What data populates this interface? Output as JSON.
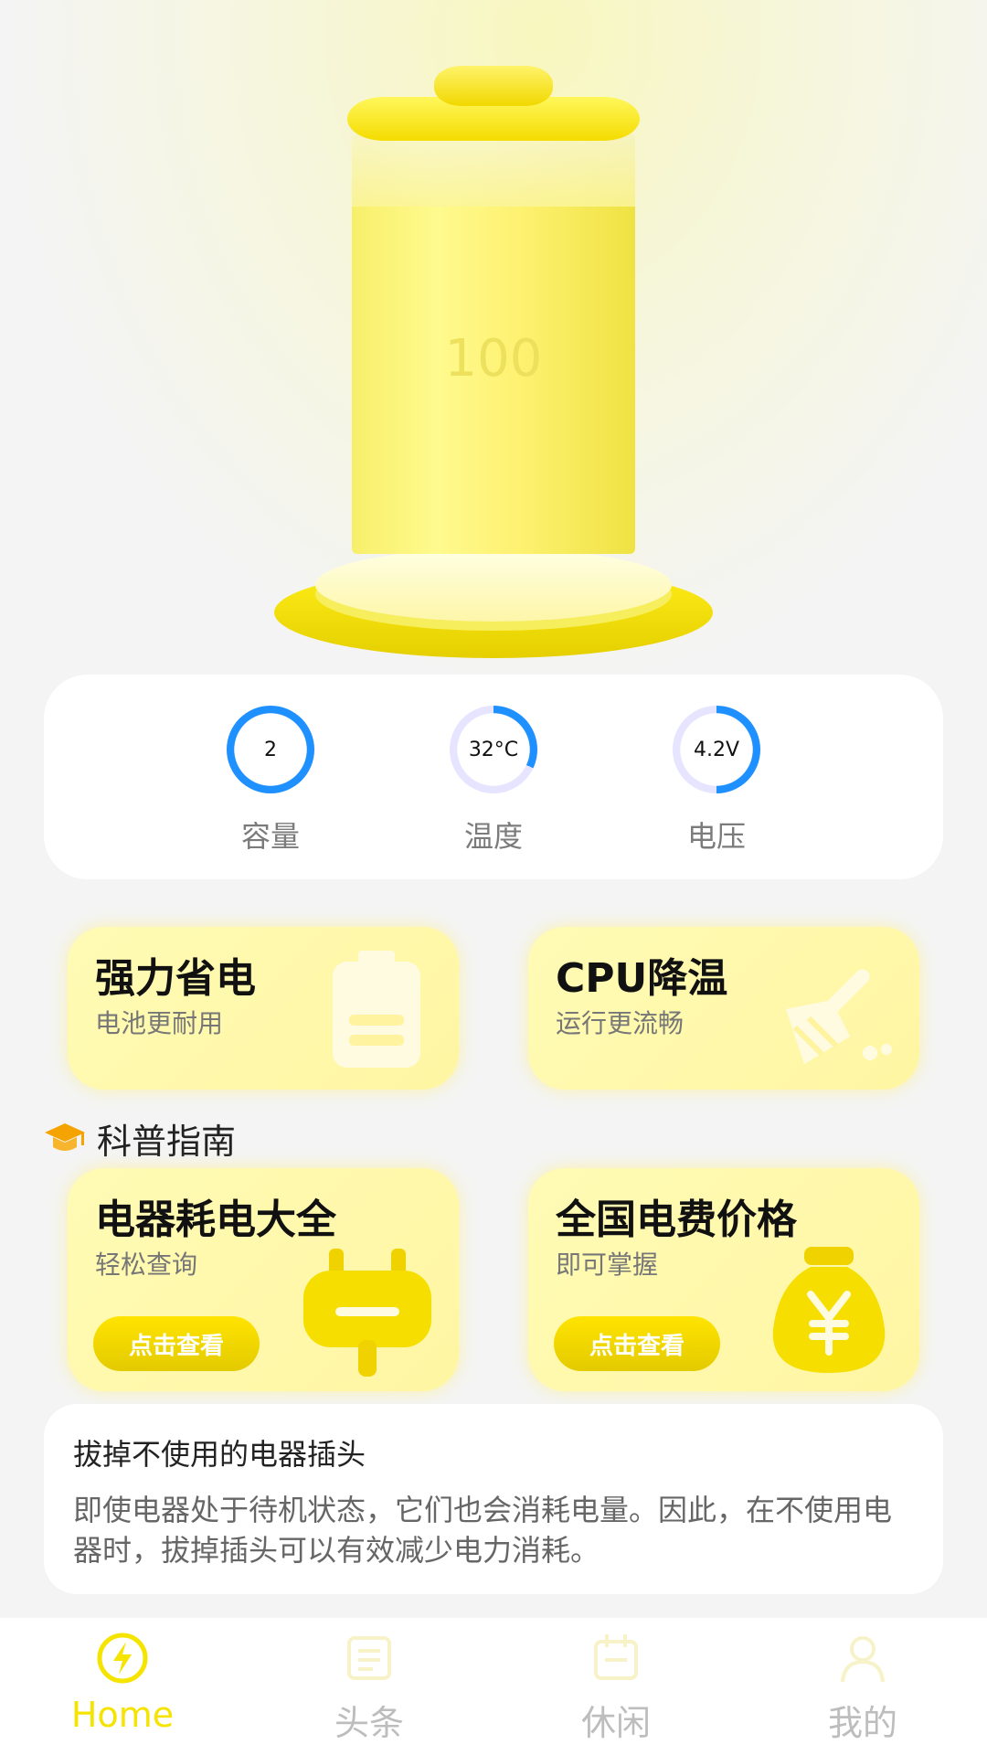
{
  "battery": {
    "level_text": "100"
  },
  "stats": [
    {
      "value": "2",
      "label": "容量",
      "ring_progress": 1.0
    },
    {
      "value": "32°C",
      "label": "温度",
      "ring_progress": 0.32
    },
    {
      "value": "4.2V",
      "label": "电压",
      "ring_progress": 0.5
    }
  ],
  "features": [
    {
      "title": "强力省电",
      "subtitle": "电池更耐用",
      "icon": "battery-icon"
    },
    {
      "title": "CPU降温",
      "subtitle": "运行更流畅",
      "icon": "broom-icon"
    }
  ],
  "section": {
    "title": "科普指南",
    "icon": "graduation-cap-icon"
  },
  "guides": [
    {
      "title": "电器耗电大全",
      "subtitle": "轻松查询",
      "button": "点击查看",
      "icon": "plug-icon"
    },
    {
      "title": "全国电费价格",
      "subtitle": "即可掌握",
      "button": "点击查看",
      "icon": "money-bag-icon"
    }
  ],
  "tip": {
    "title": "拔掉不使用的电器插头",
    "body": "即使电器处于待机状态，它们也会消耗电量。因此，在不使用电器时，拔掉插头可以有效减少电力消耗。"
  },
  "nav": [
    {
      "label": "Home",
      "active": true,
      "icon": "lightning-icon"
    },
    {
      "label": "头条",
      "active": false,
      "icon": "news-icon"
    },
    {
      "label": "休闲",
      "active": false,
      "icon": "calendar-icon"
    },
    {
      "label": "我的",
      "active": false,
      "icon": "user-icon"
    }
  ],
  "colors": {
    "accent": "#f5e300",
    "ring_blue": "#1e90ff",
    "ring_track": "#e6e4ff",
    "nav_inactive": "#bdbdbd"
  }
}
